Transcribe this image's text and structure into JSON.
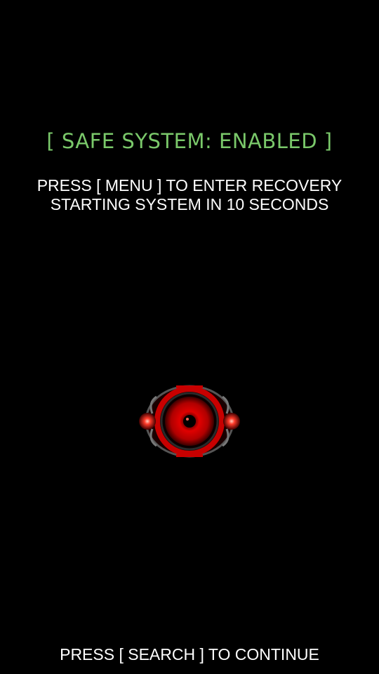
{
  "boot": {
    "status_title": "[ SAFE SYSTEM: ENABLED ]",
    "recovery_prompt": "PRESS [ MENU ] TO ENTER RECOVERY",
    "countdown_text": "STARTING SYSTEM IN 10 SECONDS",
    "continue_prompt": "PRESS [ SEARCH ] TO CONTINUE"
  },
  "colors": {
    "background": "#000000",
    "status_green": "#7ac86a",
    "text_white": "#ffffff",
    "logo_red": "#e00000"
  },
  "icons": {
    "logo": "red-eye-logo-icon"
  }
}
